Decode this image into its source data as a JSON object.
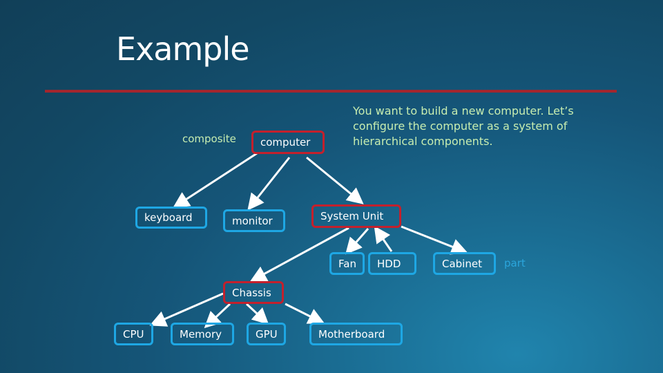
{
  "title": "Example",
  "description": "You want to build a new computer. Let’s configure the computer as a system of hierarchical components.",
  "labels": {
    "composite": "composite",
    "part": "part"
  },
  "colors": {
    "composite_border": "#c4202c",
    "part_border": "#1ea7e4",
    "composite_label": "#c7edb0",
    "part_label": "#2ba6dc",
    "rule": "#a3262e"
  },
  "nodes": {
    "computer": "computer",
    "keyboard": "keyboard",
    "monitor": "monitor",
    "system_unit": "System Unit",
    "fan": "Fan",
    "hdd": "HDD",
    "cabinet": "Cabinet",
    "chassis": "Chassis",
    "cpu": "CPU",
    "memory": "Memory",
    "gpu": "GPU",
    "motherboard": "Motherboard"
  },
  "edges": [
    {
      "from": "computer",
      "to": "keyboard"
    },
    {
      "from": "computer",
      "to": "monitor"
    },
    {
      "from": "computer",
      "to": "system_unit"
    },
    {
      "from": "system_unit",
      "to": "fan"
    },
    {
      "from": "hdd",
      "to": "system_unit"
    },
    {
      "from": "system_unit",
      "to": "cabinet"
    },
    {
      "from": "system_unit",
      "to": "chassis"
    },
    {
      "from": "chassis",
      "to": "cpu"
    },
    {
      "from": "chassis",
      "to": "memory"
    },
    {
      "from": "chassis",
      "to": "gpu"
    },
    {
      "from": "chassis",
      "to": "motherboard"
    }
  ]
}
